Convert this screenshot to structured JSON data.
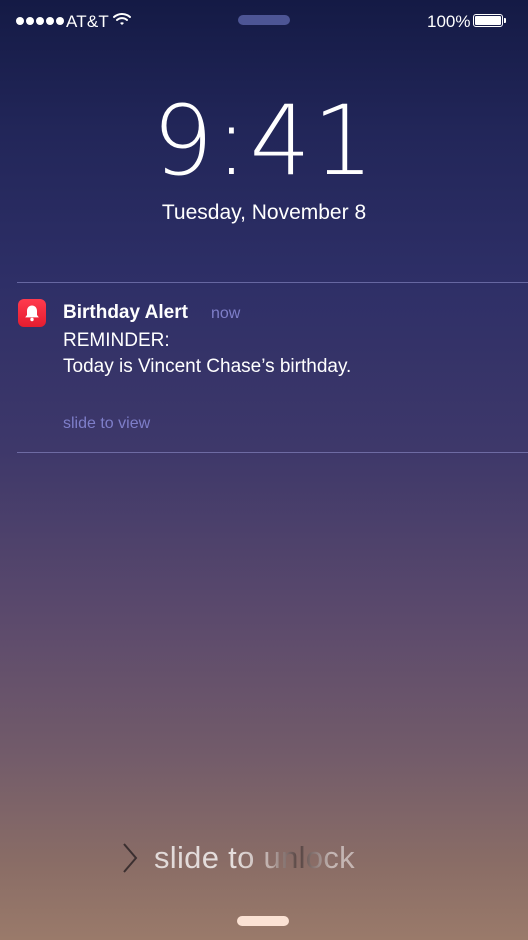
{
  "status_bar": {
    "signal_bars": 5,
    "carrier": "AT&T",
    "battery_percent": "100%",
    "battery_level": 1.0
  },
  "lock": {
    "time": "9:41",
    "date": "Tuesday, November 8"
  },
  "notification": {
    "app_name": "Birthday Alert",
    "time_ago": "now",
    "line1": "REMINDER:",
    "line2": "Today is Vincent Chase’s birthday.",
    "action_hint": "slide to view",
    "icon": "bell-icon",
    "icon_color": "#ff2d44"
  },
  "unlock": {
    "label": "slide to unlock",
    "icon": "chevron-right-icon"
  },
  "colors": {
    "accent_text": "#7e7ec9",
    "home_indicator": "#fbe2d4",
    "top_indicator": "#4d5595"
  }
}
